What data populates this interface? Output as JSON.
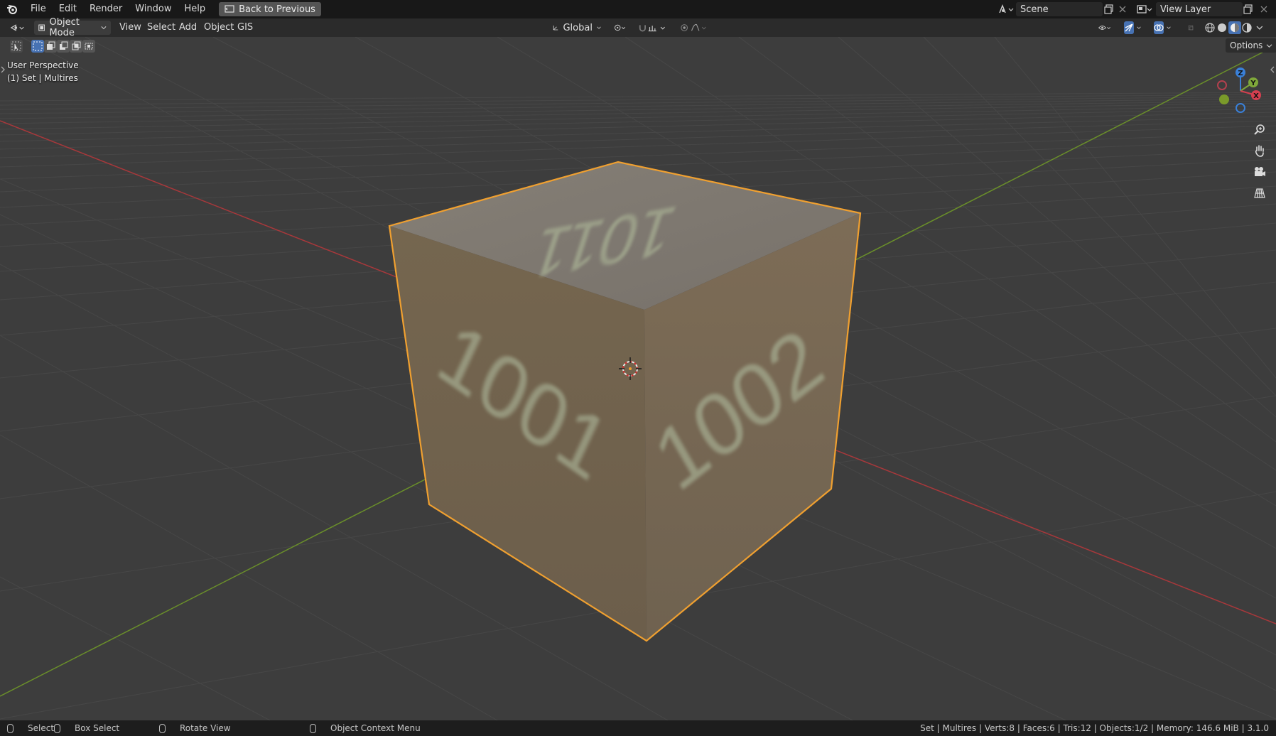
{
  "menu": {
    "file": "File",
    "edit": "Edit",
    "render": "Render",
    "window": "Window",
    "help": "Help"
  },
  "back_button": "Back to Previous",
  "scene": {
    "name": "Scene"
  },
  "view_layer": {
    "name": "View Layer"
  },
  "header": {
    "mode": "Object Mode",
    "view": "View",
    "select": "Select",
    "add": "Add",
    "object": "Object",
    "gis": "GIS",
    "orientation": "Global",
    "options": "Options"
  },
  "viewport": {
    "perspective": "User Perspective",
    "collection": "(1) Set | Multires"
  },
  "gizmo": {
    "z": "Z",
    "y": "Y",
    "x": "X"
  },
  "cube": {
    "top_text": "1011",
    "left_text": "1001",
    "right_text": "1002"
  },
  "status": {
    "select": "Select",
    "box_select": "Box Select",
    "rotate_view": "Rotate View",
    "context_menu": "Object Context Menu",
    "stats": "Set | Multires | Verts:8 | Faces:6 | Tris:12 | Objects:1/2 | Memory: 146.6 MiB | 3.1.0"
  },
  "colors": {
    "selection": "#f0a030",
    "x_axis": "#c83a3a",
    "y_axis": "#6a9a2a",
    "z_axis": "#3a80d8",
    "cube_top": "#7f7a72",
    "cube_left": "#70624f",
    "cube_right": "#7a6a57"
  }
}
